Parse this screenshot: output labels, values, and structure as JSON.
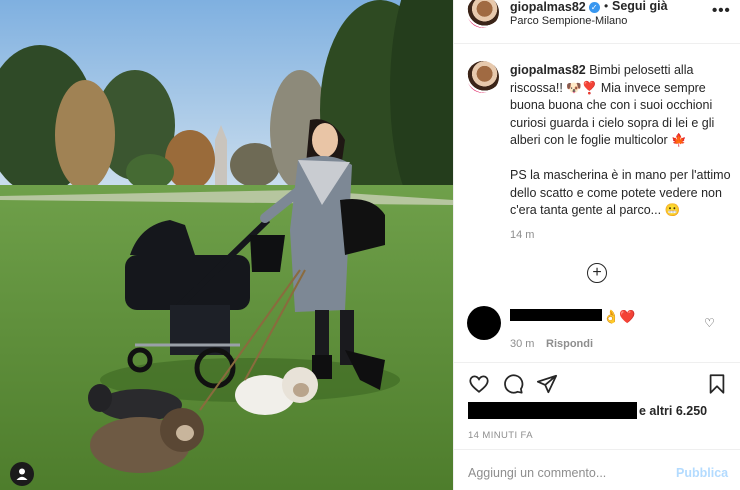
{
  "post": {
    "photo_alt": "",
    "user_tag_icon": "person-icon"
  },
  "header": {
    "username": "giopalmas82",
    "verified_mark": "✓",
    "separator": "•",
    "follow_label": "Segui già",
    "location": "Parco Sempione-Milano",
    "more_icon": "•••"
  },
  "caption": {
    "username": "giopalmas82",
    "line1": " Bimbi pelosetti alla riscossa!! 🐶❣️ Mia invece sempre buona buona che con i suoi occhioni curiosi guarda i cielo sopra di lei e gli alberi con le foglie multicolor 🍁",
    "line2": "PS la mascherina è in mano per l'attimo dello scatto e come potete vedere non c'era tanta gente al parco... 😬",
    "time": "14 m",
    "load_more": "+"
  },
  "comment": {
    "emoji": "👌❤️",
    "heart": "♡",
    "time": "30 m",
    "reply_label": "Rispondi"
  },
  "actions": {
    "like_icon": "heart-outline-icon",
    "comment_icon": "comment-bubble-icon",
    "share_icon": "paper-plane-icon",
    "save_icon": "bookmark-icon"
  },
  "likes": {
    "text": "e altri 6.250"
  },
  "post_time": "14 MINUTI FA",
  "comment_box": {
    "placeholder": "Aggiungi un commento...",
    "publish_label": "Pubblica"
  },
  "colors": {
    "verified": "#3897f0",
    "publish_disabled": "#b3dbff",
    "secondary_text": "#8e8e8e"
  }
}
